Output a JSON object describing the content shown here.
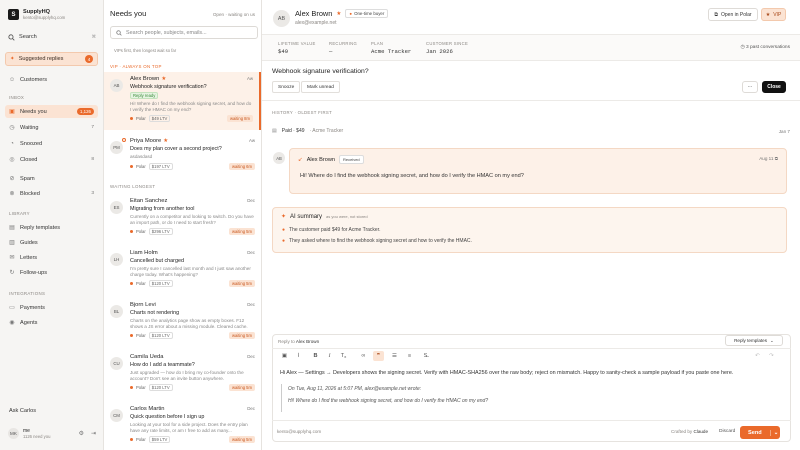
{
  "workspace": {
    "name": "SupplyHQ",
    "email": "kento@supplyhq.com",
    "logo_letter": "S"
  },
  "sidebar": {
    "search_label": "Search",
    "search_kbd": "⌘",
    "suggested": {
      "label": "Suggested replies",
      "count": "4"
    },
    "customers": "Customers",
    "inbox_section": "INBOX",
    "inbox": [
      {
        "label": "Needs you",
        "count": "1,126"
      },
      {
        "label": "Waiting",
        "count": "7"
      },
      {
        "label": "Snoozed",
        "count": ""
      },
      {
        "label": "Closed",
        "count": "8"
      },
      {
        "label": "Spam",
        "count": ""
      },
      {
        "label": "Blocked",
        "count": "3"
      }
    ],
    "library_section": "LIBRARY",
    "library": [
      "Reply templates",
      "Guides",
      "Letters",
      "Follow-ups"
    ],
    "integrations_section": "INTEGRATIONS",
    "integrations": [
      "Payments",
      "Agents"
    ],
    "ask": "Ask Carlos",
    "user": {
      "initials": "MK",
      "name": "me",
      "status": "1126 need you"
    }
  },
  "list": {
    "title": "Needs you",
    "filter": "Open · waiting on us",
    "search_placeholder": "Search people, subjects, emails...",
    "note": "VIPs first, then longest wait so far",
    "group_vip": "VIP · ALWAYS ON TOP",
    "group_waiting": "WAITING LONGEST",
    "vip": [
      {
        "initials": "AB",
        "name": "Alex Brown",
        "time": "Aw",
        "subject": "Webhook signature verification?",
        "ready": "Reply ready",
        "preview": "Hi! Where do I find the webhook signing secret, and how do I verify the HMAC on my end?",
        "source": "Polar",
        "ltv": "$49 LTV",
        "wait": "waiting 8m"
      },
      {
        "initials": "PM",
        "name": "Priya Moore",
        "time": "Aw",
        "subject": "Does my plan cover a second project?",
        "ready": "",
        "preview": "asdasdasd",
        "source": "Polar",
        "ltv": "$197 LTV",
        "wait": "waiting 6m"
      }
    ],
    "waiting": [
      {
        "initials": "ES",
        "name": "Eitan Sanchez",
        "time": "Dec",
        "subject": "Migrating from another tool",
        "preview": "Currently on a competitor and looking to switch. Do you have an import path, or do I need to start fresh?",
        "source": "Polar",
        "ltv": "$296 LTV",
        "wait": "waiting 5m"
      },
      {
        "initials": "LH",
        "name": "Liam Holm",
        "time": "Dec",
        "subject": "Cancelled but charged",
        "preview": "I'm pretty sure I cancelled last month and I just saw another charge today. What's happening?",
        "source": "Polar",
        "ltv": "$120 LTV",
        "wait": "waiting 5m"
      },
      {
        "initials": "BL",
        "name": "Bjorn Levi",
        "time": "Dec",
        "subject": "Charts not rendering",
        "preview": "Charts on the analytics page show as empty boxes. F12 shows a JS error about a missing module. Cleared cache.",
        "source": "Polar",
        "ltv": "$120 LTV",
        "wait": "waiting 5m"
      },
      {
        "initials": "CU",
        "name": "Camila Ueda",
        "time": "Dec",
        "subject": "How do I add a teammate?",
        "preview": "Just upgraded — how do I bring my co-founder onto the account? Don't see an invite button anywhere.",
        "source": "Polar",
        "ltv": "$120 LTV",
        "wait": "waiting 5m"
      },
      {
        "initials": "CM",
        "name": "Carlos Martin",
        "time": "Dec",
        "subject": "Quick question before I sign up",
        "preview": "Looking at your tool for a side project. Does the entry plan have any rate limits, or am I free to add as many...",
        "source": "Polar",
        "ltv": "$59 LTV",
        "wait": "waiting 5m"
      }
    ]
  },
  "detail": {
    "initials": "AB",
    "name": "Alex Brown",
    "buyer_badge": "One-time buyer",
    "email": "alex@example.net",
    "open_in_polar": "Open in Polar",
    "vip": "VIP",
    "stats": [
      {
        "label": "LIFETIME VALUE",
        "value": "$49"
      },
      {
        "label": "RECURRING",
        "value": "—"
      },
      {
        "label": "PLAN",
        "value": "Acme Tracker"
      },
      {
        "label": "CUSTOMER SINCE",
        "value": "Jan 2026"
      }
    ],
    "past_conversations": "3 past conversations",
    "subject": "Webhook signature verification?",
    "actions": [
      "Snooze",
      "Mark unread"
    ],
    "more": "···",
    "close": "Close",
    "history_label": "HISTORY · OLDEST FIRST",
    "paid": {
      "label": "Paid · $49",
      "product": "· Acme Tracker",
      "date": "Jan 7"
    },
    "message": {
      "initials": "AB",
      "name": "Alex Brown",
      "status": "Received",
      "date": "Aug 11",
      "body": "Hi! Where do I find the webhook signing secret, and how do I verify the HMAC on my end?"
    },
    "summary": {
      "title": "AI summary",
      "note": "as you were, not stored",
      "points": [
        "The customer paid $49 for Acme Tracker.",
        "They asked where to find the webhook signing secret and how to verify the HMAC."
      ]
    },
    "composer": {
      "reply_to": "Reply to",
      "reply_to_name": "Alex Brown",
      "templates": "Reply templates",
      "body": "Hi Alex — Settings → Developers shows the signing secret. Verify with HMAC-SHA256 over the raw body; reject on mismatch. Happy to sanity-check a sample payload if you paste one here.",
      "quote_header": "On Tue, Aug 11, 2026 at 5:07 PM, alex@example.net wrote:",
      "quote_body": "Hi! Where do I find the webhook signing secret, and how do I verify the HMAC on my end?",
      "from": "kento@supplyhq.com",
      "crafted": "Crafted by",
      "crafted_by": "Claude",
      "discard": "Discard",
      "send": "Send"
    }
  },
  "colors": {
    "accent": "#ea6a2b",
    "accent_soft": "#fbe3d3"
  }
}
